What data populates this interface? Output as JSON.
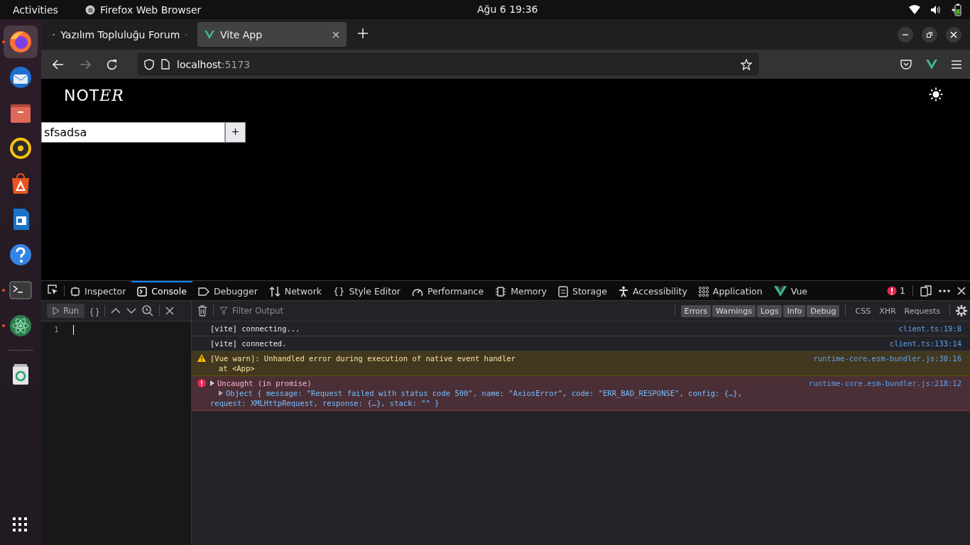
{
  "topbar": {
    "activities": "Activities",
    "app": "Firefox Web Browser",
    "clock": "Ağu 6  19:36"
  },
  "dock": [
    {
      "kind": "firefox",
      "running": true,
      "selected": true
    },
    {
      "kind": "mail",
      "running": false,
      "selected": false
    },
    {
      "kind": "files",
      "running": false,
      "selected": false
    },
    {
      "kind": "speaker",
      "running": false,
      "selected": false
    },
    {
      "kind": "store",
      "running": false,
      "selected": false
    },
    {
      "kind": "writer",
      "running": false,
      "selected": false
    },
    {
      "kind": "help",
      "running": false,
      "selected": false
    },
    {
      "kind": "terminal",
      "running": true,
      "selected": false
    },
    {
      "kind": "atom",
      "running": true,
      "selected": false
    },
    {
      "kind": "trash",
      "running": false,
      "selected": false
    }
  ],
  "tabs": [
    {
      "title": "Yazılım Topluluğu Forum",
      "selected": false,
      "kind": "forum"
    },
    {
      "title": "Vite App",
      "selected": true,
      "kind": "vite"
    }
  ],
  "url": {
    "host": "localhost",
    "port": ":5173"
  },
  "page": {
    "logo": "NOT",
    "logo_script": "ER",
    "input_value": "sfsadsa",
    "add_button": "+"
  },
  "devtools": {
    "tools": [
      {
        "label": "Inspector",
        "kind": "inspector",
        "selected": false
      },
      {
        "label": "Console",
        "kind": "console",
        "selected": true
      },
      {
        "label": "Debugger",
        "kind": "debugger",
        "selected": false
      },
      {
        "label": "Network",
        "kind": "network",
        "selected": false
      },
      {
        "label": "Style Editor",
        "kind": "glyph",
        "glyph": "{}",
        "selected": false
      },
      {
        "label": "Performance",
        "kind": "performance",
        "selected": false
      },
      {
        "label": "Memory",
        "kind": "memory",
        "selected": false
      },
      {
        "label": "Storage",
        "kind": "storage",
        "selected": false
      },
      {
        "label": "Accessibility",
        "kind": "accessibility",
        "selected": false
      },
      {
        "label": "Application",
        "kind": "application",
        "selected": false
      },
      {
        "label": "Vue",
        "kind": "vue",
        "selected": false
      }
    ],
    "error_count": "1",
    "editor": {
      "run": "Run",
      "braces": "{ }",
      "line_number": "1"
    },
    "filter_placeholder": "Filter Output",
    "levels": [
      {
        "label": "Errors",
        "selected": true
      },
      {
        "label": "Warnings",
        "selected": true
      },
      {
        "label": "Logs",
        "selected": true
      },
      {
        "label": "Info",
        "selected": true
      },
      {
        "label": "Debug",
        "selected": true
      }
    ],
    "types": [
      {
        "label": "CSS",
        "selected": false
      },
      {
        "label": "XHR",
        "selected": false
      },
      {
        "label": "Requests",
        "selected": false
      }
    ],
    "messages": [
      {
        "kind": "log",
        "lines": [
          "[vite] connecting..."
        ],
        "source": "client.ts:19:8"
      },
      {
        "kind": "log",
        "lines": [
          "[vite] connected."
        ],
        "source": "client.ts:133:14"
      },
      {
        "kind": "warn",
        "lines": [
          "[Vue warn]: Unhandled error during execution of native event handler",
          "at <App>"
        ],
        "source": "runtime-core.esm-bundler.js:38:16"
      },
      {
        "kind": "error",
        "lines": [
          "Uncaught (in promise)"
        ],
        "detail": [
          "Object { message: \"Request failed with status code 500\", name: \"AxiosError\", code: \"ERR_BAD_RESPONSE\", config: {…},",
          "request: XMLHttpRequest, response: {…}, stack: \"\" }"
        ],
        "source": "runtime-core.esm-bundler.js:218:12"
      }
    ]
  }
}
